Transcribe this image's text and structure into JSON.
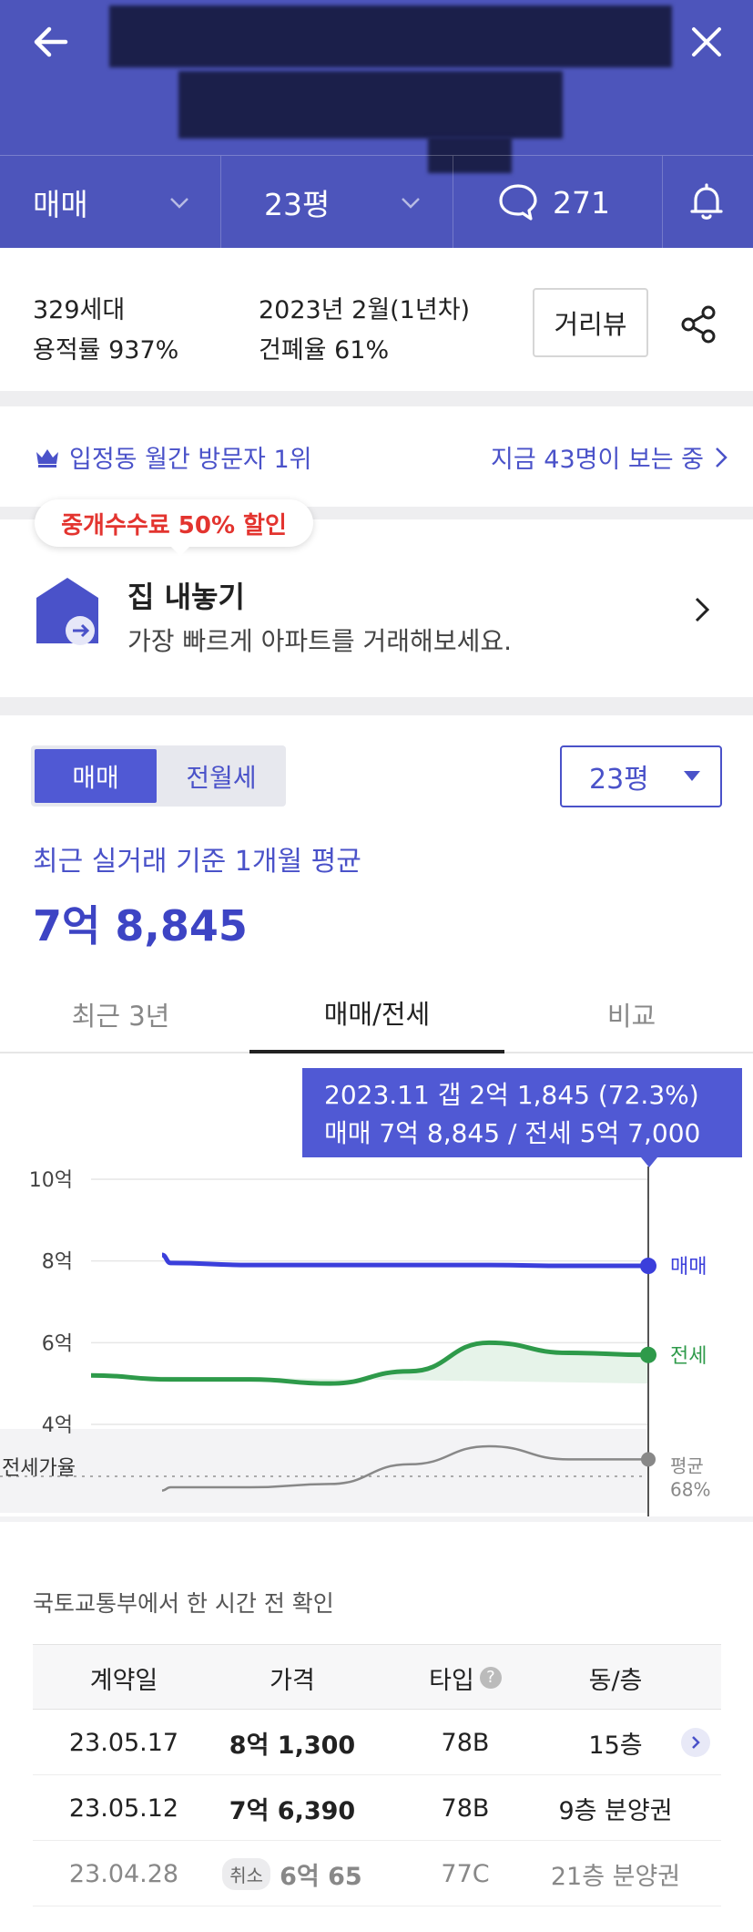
{
  "header": {
    "filters": {
      "deal_type": "매매",
      "size": "23평",
      "comments": "271"
    }
  },
  "info": {
    "households": "329세대",
    "far": "용적률 937%",
    "built": "2023년 2월(1년차)",
    "bcr": "건폐율 61%",
    "street_view": "거리뷰"
  },
  "visitors": {
    "rank": "입정동 월간 방문자 1위",
    "now_viewing": "지금 43명이 보는 중"
  },
  "sell_card": {
    "badge": "중개수수료 50% 할인",
    "title": "집 내놓기",
    "subtitle": "가장 빠르게 아파트를 거래해보세요."
  },
  "price": {
    "seg_sale": "매매",
    "seg_lease": "전월세",
    "size_select": "23평",
    "basis": "최근 실거래 기준 1개월 평균",
    "value": "7억 8,845"
  },
  "tabs": [
    "최근 3년",
    "매매/전세",
    "비교"
  ],
  "tooltip": {
    "line1": "2023.11  갭 2억 1,845 (72.3%)",
    "line2": "매매 7억 8,845 / 전세 5억 7,000"
  },
  "chart_data": {
    "type": "line",
    "y_ticks": [
      "10억",
      "8억",
      "6억",
      "4억"
    ],
    "ylim": [
      4,
      10
    ],
    "ratio_label": "전세가율",
    "series": [
      {
        "name": "매매",
        "color": "#3b3fdb",
        "values": [
          8.15,
          7.95,
          7.9,
          7.9,
          7.9,
          7.9,
          7.88,
          7.88
        ]
      },
      {
        "name": "전세",
        "color": "#2e9a4a",
        "values": [
          5.2,
          5.1,
          5.1,
          5.0,
          5.3,
          6.0,
          5.75,
          5.7
        ]
      },
      {
        "name": "평균",
        "color": "#888888",
        "values": [
          0.4,
          0.5,
          0.5,
          0.6,
          1.2,
          1.75,
          1.35,
          1.35
        ]
      }
    ],
    "ratio_end_label": "평균",
    "ratio_end_value": "68%"
  },
  "table": {
    "confirm": "국토교통부에서 한 시간 전 확인",
    "headers": [
      "계약일",
      "가격",
      "타입",
      "동/층"
    ],
    "rows": [
      {
        "date": "23.05.17",
        "price": "8억 1,300",
        "type": "78B",
        "floor": "15층",
        "cancel": ""
      },
      {
        "date": "23.05.12",
        "price": "7억 6,390",
        "type": "78B",
        "floor": "9층 분양권",
        "cancel": ""
      },
      {
        "date": "23.04.28",
        "price": "6억 65",
        "type": "77C",
        "floor": "21층 분양권",
        "cancel": "취소"
      }
    ]
  }
}
